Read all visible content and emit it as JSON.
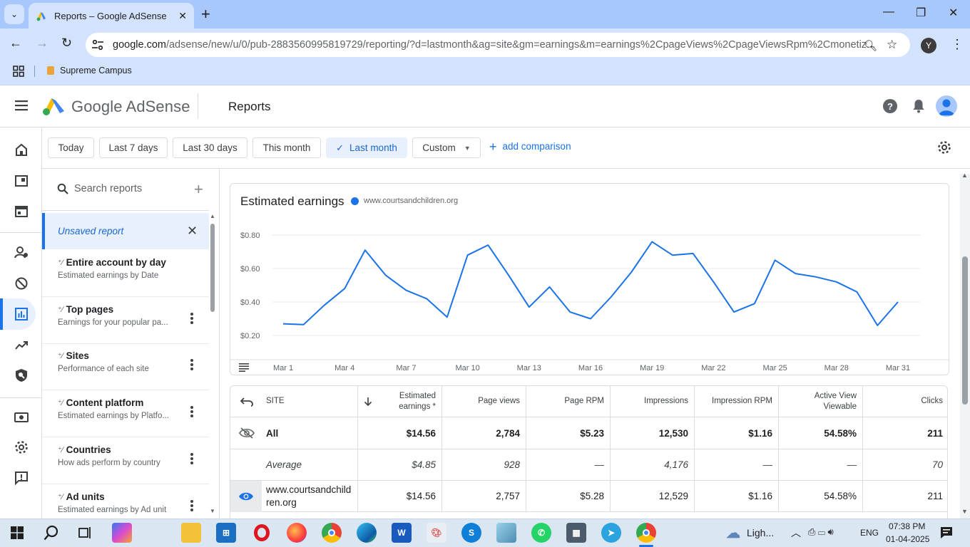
{
  "browser": {
    "tab_title": "Reports – Google AdSense",
    "url_host": "google.com",
    "url_path": "/adsense/new/u/0/pub-2883560995819729/reporting/?d=lastmonth&ag=site&gm=earnings&m=earnings%2CpageViews%2CpageViewsRpm%2Cmonetiz...",
    "profile_letter": "Y",
    "bookmark": "Supreme Campus"
  },
  "header": {
    "product_name": "Google AdSense",
    "page_title": "Reports"
  },
  "date_chips": [
    "Today",
    "Last 7 days",
    "Last 30 days",
    "This month",
    "Last month",
    "Custom"
  ],
  "active_date_chip": "Last month",
  "add_comparison": "add comparison",
  "sidebar": {
    "search_placeholder": "Search reports",
    "unsaved": "Unsaved report",
    "reports": [
      {
        "title": "Entire account by day",
        "subtitle": "Estimated earnings by Date"
      },
      {
        "title": "Top pages",
        "subtitle": "Earnings for your popular pa..."
      },
      {
        "title": "Sites",
        "subtitle": "Performance of each site"
      },
      {
        "title": "Content platform",
        "subtitle": "Estimated earnings by Platfo..."
      },
      {
        "title": "Countries",
        "subtitle": "How ads perform by country"
      },
      {
        "title": "Ad units",
        "subtitle": "Estimated earnings by Ad unit"
      }
    ]
  },
  "chart_data": {
    "type": "line",
    "title": "Estimated earnings",
    "series": [
      {
        "name": "www.courtsandchildren.org",
        "color": "#1a73e8",
        "values": [
          0.27,
          0.265,
          0.38,
          0.48,
          0.71,
          0.56,
          0.47,
          0.42,
          0.31,
          0.68,
          0.74,
          0.56,
          0.37,
          0.49,
          0.34,
          0.3,
          0.43,
          0.58,
          0.76,
          0.68,
          0.69,
          0.52,
          0.34,
          0.39,
          0.65,
          0.57,
          0.55,
          0.52,
          0.46,
          0.26,
          0.4
        ]
      }
    ],
    "x": [
      "Mar 1",
      "Mar 2",
      "Mar 3",
      "Mar 4",
      "Mar 5",
      "Mar 6",
      "Mar 7",
      "Mar 8",
      "Mar 9",
      "Mar 10",
      "Mar 11",
      "Mar 12",
      "Mar 13",
      "Mar 14",
      "Mar 15",
      "Mar 16",
      "Mar 17",
      "Mar 18",
      "Mar 19",
      "Mar 20",
      "Mar 21",
      "Mar 22",
      "Mar 23",
      "Mar 24",
      "Mar 25",
      "Mar 26",
      "Mar 27",
      "Mar 28",
      "Mar 29",
      "Mar 30",
      "Mar 31"
    ],
    "x_tick_labels": [
      "Mar 1",
      "Mar 4",
      "Mar 7",
      "Mar 10",
      "Mar 13",
      "Mar 16",
      "Mar 19",
      "Mar 22",
      "Mar 25",
      "Mar 28",
      "Mar 31"
    ],
    "y_ticks": [
      "$0.20",
      "$0.40",
      "$0.60",
      "$0.80"
    ],
    "y_tick_values": [
      0.2,
      0.4,
      0.6,
      0.8
    ],
    "ylim": [
      0.0,
      0.8
    ],
    "grid": true
  },
  "table": {
    "columns": [
      "SITE",
      "Estimated earnings *",
      "Page views",
      "Page RPM",
      "Impressions",
      "Impression RPM",
      "Active View Viewable",
      "Clicks"
    ],
    "rows": [
      {
        "label": "All",
        "values": [
          "$14.56",
          "2,784",
          "$5.23",
          "12,530",
          "$1.16",
          "54.58%",
          "211"
        ]
      },
      {
        "label": "Average",
        "values": [
          "$4.85",
          "928",
          "—",
          "4,176",
          "—",
          "—",
          "70"
        ]
      },
      {
        "label": "www.courtsandchildren.org",
        "values": [
          "$14.56",
          "2,757",
          "$5.28",
          "12,529",
          "$1.16",
          "54.58%",
          "211"
        ]
      }
    ]
  },
  "taskbar": {
    "weather": "Ligh...",
    "lang": "ENG",
    "time": "07:38 PM",
    "date": "01-04-2025"
  }
}
